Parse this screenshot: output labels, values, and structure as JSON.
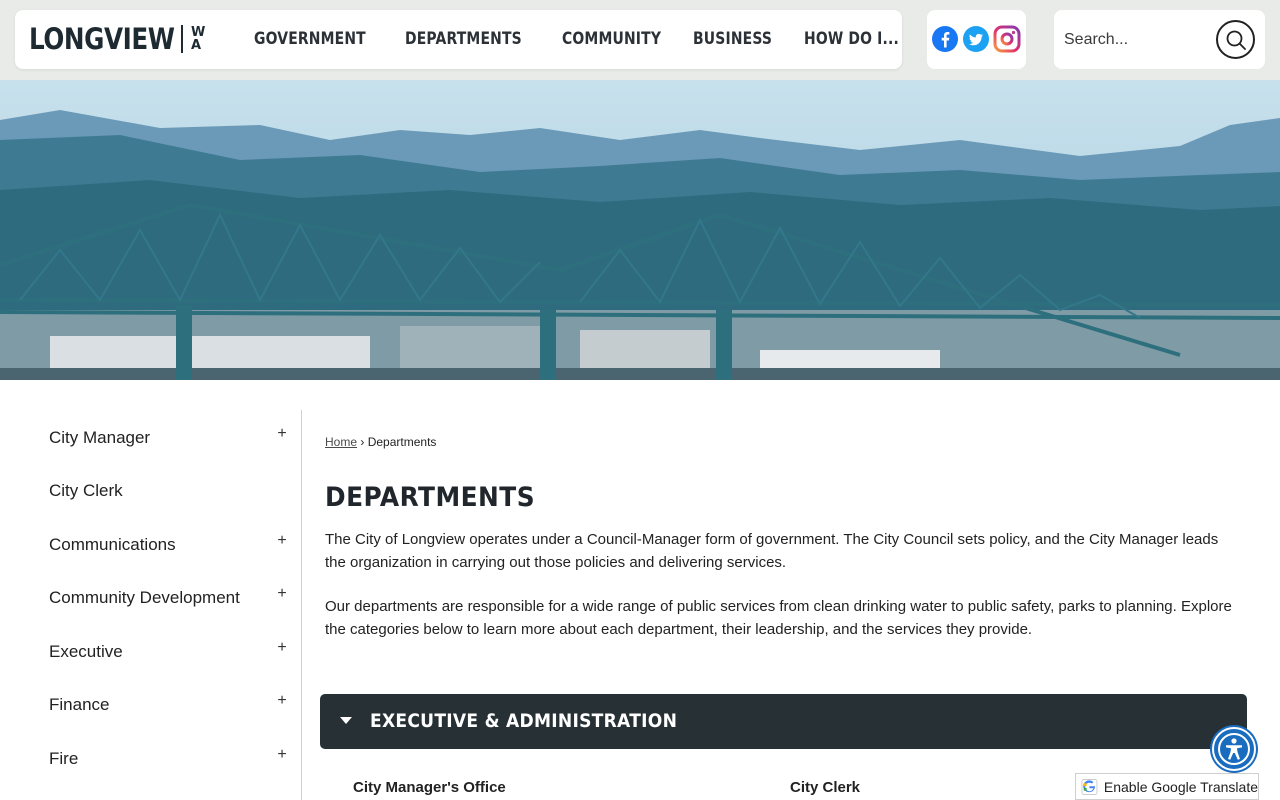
{
  "header": {
    "logo": {
      "text": "LONGVIEW",
      "state_top": "W",
      "state_bottom": "A"
    },
    "nav": [
      "GOVERNMENT",
      "DEPARTMENTS",
      "COMMUNITY",
      "BUSINESS",
      "HOW DO I..."
    ],
    "social": [
      "facebook-icon",
      "twitter-icon",
      "instagram-icon"
    ],
    "search": {
      "placeholder": "Search..."
    }
  },
  "sidebar": {
    "items": [
      {
        "label": "City Manager",
        "expandable": true
      },
      {
        "label": "City Clerk",
        "expandable": false
      },
      {
        "label": "Communications",
        "expandable": true
      },
      {
        "label": "Community Development",
        "expandable": true
      },
      {
        "label": "Executive",
        "expandable": true
      },
      {
        "label": "Finance",
        "expandable": true
      },
      {
        "label": "Fire",
        "expandable": true
      }
    ],
    "expand_symbol": "+"
  },
  "breadcrumb": {
    "home": "Home",
    "separator": "›",
    "current": "Departments"
  },
  "main": {
    "title": "DEPARTMENTS",
    "paragraphs": [
      "The City of Longview operates under a Council-Manager form of government. The City Council sets policy, and the City Manager leads the organization in carrying out those policies and delivering services.",
      "Our departments are responsible for a wide range of public services from clean drinking water to public safety, parks to planning. Explore the categories below to learn more about each department, their leadership, and the services they provide."
    ],
    "accordion": {
      "title": "EXECUTIVE & ADMINISTRATION",
      "links": [
        "City Manager's Office",
        "City Clerk"
      ]
    }
  },
  "widgets": {
    "translate_label": "Enable Google Translate",
    "accessibility_icon": "accessibility-icon"
  },
  "colors": {
    "topbar_bg": "#e9ebe8",
    "accordion_bg": "#263035",
    "accessibility_blue": "#1a6cbf",
    "facebook_blue": "#1877f2",
    "twitter_blue": "#1da1f2"
  }
}
